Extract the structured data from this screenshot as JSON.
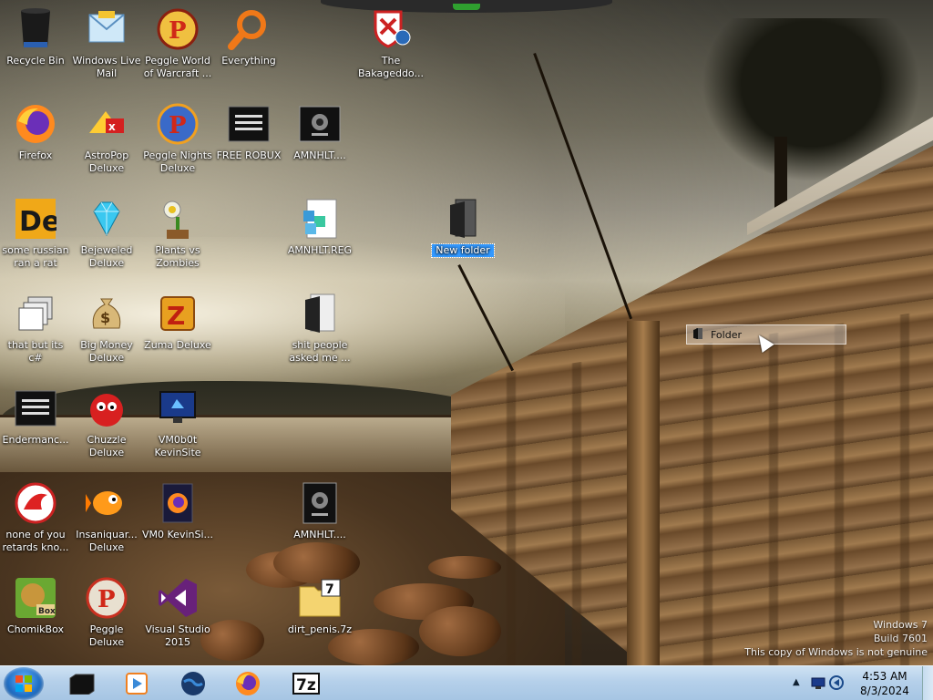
{
  "desktop": {
    "icons": [
      {
        "id": "recycle-bin",
        "label": "Recycle Bin",
        "icon": "recycle-bin-icon"
      },
      {
        "id": "windows-live-mail",
        "label": "Windows Live Mail",
        "icon": "mail-icon"
      },
      {
        "id": "peggle-wow",
        "label": "Peggle World of Warcraft ...",
        "icon": "peggle-icon"
      },
      {
        "id": "everything",
        "label": "Everything",
        "icon": "magnifier-icon"
      },
      {
        "id": "bakageddon",
        "label": "The Bakageddo...",
        "icon": "shield-icon"
      },
      {
        "id": "firefox",
        "label": "Firefox",
        "icon": "firefox-icon"
      },
      {
        "id": "astropop",
        "label": "AstroPop Deluxe",
        "icon": "astropop-icon"
      },
      {
        "id": "peggle-nights",
        "label": "Peggle Nights Deluxe",
        "icon": "peggle-nights-icon"
      },
      {
        "id": "free-robux",
        "label": "FREE ROBUX",
        "icon": "console-icon"
      },
      {
        "id": "amnhlt-1",
        "label": "AMNHLT....",
        "icon": "app-icon"
      },
      {
        "id": "some-russian",
        "label": "some russian ran a rat",
        "icon": "de-icon"
      },
      {
        "id": "bejeweled",
        "label": "Bejeweled Deluxe",
        "icon": "gem-icon"
      },
      {
        "id": "plants-vs-zombies",
        "label": "Plants vs Zombies",
        "icon": "plant-icon"
      },
      {
        "id": "amnhlt-reg",
        "label": "AMNHLT.REG",
        "icon": "registry-icon"
      },
      {
        "id": "new-folder",
        "label": "New folder",
        "icon": "folder-icon",
        "selected": true
      },
      {
        "id": "that-but-its-c",
        "label": "that but its c#",
        "icon": "windows-stack-icon"
      },
      {
        "id": "big-money",
        "label": "Big Money Deluxe",
        "icon": "money-bag-icon"
      },
      {
        "id": "zuma",
        "label": "Zuma Deluxe",
        "icon": "zuma-icon"
      },
      {
        "id": "shit-people",
        "label": "shit people asked me ...",
        "icon": "folder-dark-icon"
      },
      {
        "id": "endermanc",
        "label": "Endermanc...",
        "icon": "console-icon"
      },
      {
        "id": "chuzzle",
        "label": "Chuzzle Deluxe",
        "icon": "chuzzle-icon"
      },
      {
        "id": "vm0b0t",
        "label": "VM0b0t KevinSite",
        "icon": "monitor-icon"
      },
      {
        "id": "none-of-you",
        "label": "none of you retards kno...",
        "icon": "dragon-icon"
      },
      {
        "id": "insaniquarium",
        "label": "Insaniquar... Deluxe",
        "icon": "fish-icon"
      },
      {
        "id": "vm0-kevinsi",
        "label": "VM0 KevinSi...",
        "icon": "firefox-file-icon"
      },
      {
        "id": "amnhlt-2",
        "label": "AMNHLT....",
        "icon": "app-icon"
      },
      {
        "id": "chomikbox",
        "label": "ChomikBox",
        "icon": "hamster-icon"
      },
      {
        "id": "peggle-deluxe",
        "label": "Peggle Deluxe",
        "icon": "peggle-icon"
      },
      {
        "id": "visual-studio",
        "label": "Visual Studio 2015",
        "icon": "visual-studio-icon"
      },
      {
        "id": "dirt-penis",
        "label": "dirt_penis.7z",
        "icon": "archive-7z-icon"
      }
    ],
    "drag_ghost_label": "Folder",
    "watermark": {
      "line1": "Windows 7",
      "line2": "Build 7601",
      "line3": "This copy of Windows is not genuine"
    }
  },
  "taskbar": {
    "pinned": [
      {
        "name": "explorer",
        "icon": "folder-black-icon"
      },
      {
        "name": "media-player",
        "icon": "media-player-icon"
      },
      {
        "name": "globe",
        "icon": "globe-icon"
      },
      {
        "name": "firefox",
        "icon": "firefox-icon"
      },
      {
        "name": "7zip",
        "icon": "7zip-icon",
        "text": "7z"
      }
    ],
    "tray_arrow": "▲",
    "clock": {
      "time": "4:53 AM",
      "date": "8/3/2024"
    }
  }
}
